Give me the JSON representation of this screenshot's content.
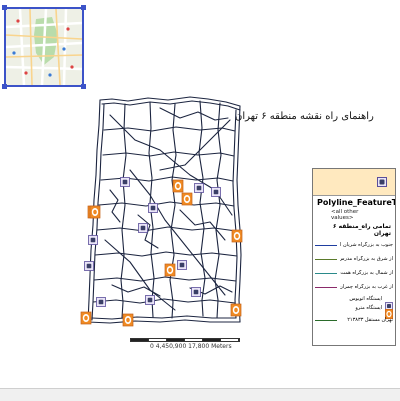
{
  "map": {
    "title": "راهنمای راه نقشه منطقه ۶ تهران",
    "scale_label": "0 4,450,900 17,800 Meters",
    "colors": {
      "road": "#1c2540",
      "selection": "#3c53c8",
      "legend_header": "#ffe9bf",
      "marker_orange": "#f08a23"
    },
    "markers": [
      {
        "type": "metro"
      },
      {
        "type": "bus"
      },
      {
        "type": "bus"
      },
      {
        "type": "metro"
      },
      {
        "type": "bus"
      },
      {
        "type": "metro"
      },
      {
        "type": "bus"
      },
      {
        "type": "metro"
      },
      {
        "type": "bus"
      },
      {
        "type": "metro"
      },
      {
        "type": "bus"
      },
      {
        "type": "bus"
      },
      {
        "type": "metro"
      },
      {
        "type": "bus"
      },
      {
        "type": "metro"
      },
      {
        "type": "bus"
      },
      {
        "type": "metro"
      },
      {
        "type": "bus"
      },
      {
        "type": "bus"
      },
      {
        "type": "metro"
      }
    ]
  },
  "legend": {
    "header_icon": "bus-stop-icon",
    "field": "Polyline_FeatureToL",
    "other_values": "<all other values>",
    "road_group": "تمامی راه_منطقه ۶ تهران",
    "roads": [
      {
        "label": "جنوب به بزرگراه شریان انقلاب",
        "color": "#1f3ea0"
      },
      {
        "label": "از شرق به بزرگراه مدرس",
        "color": "#5a7a2a"
      },
      {
        "label": "از شمال به بزرگراه همت",
        "color": "#2a8a8a"
      },
      {
        "label": "از غرب به بزرگراه چمران",
        "color": "#8a2a6a"
      }
    ],
    "symbols": [
      {
        "label": "ایستگاه اتوبوس",
        "icon": "bus-stop-icon"
      },
      {
        "label": "ایستگاه مترو",
        "icon": "metro-icon"
      }
    ],
    "extra_road_label": "نهران مستقل ۲۱۳۸۳۳",
    "extra_road_color": "#2a6b2a"
  },
  "overview": {
    "content": "city-overview-map"
  }
}
